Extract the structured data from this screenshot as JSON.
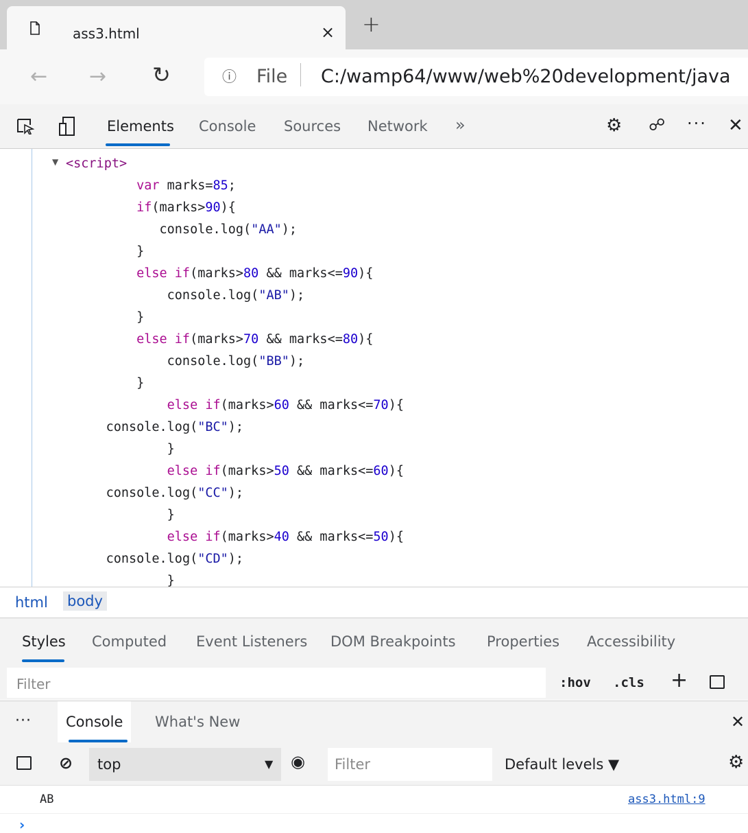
{
  "browser": {
    "tab_title": "ass3.html",
    "tab_close": "×",
    "new_tab": "+",
    "nav_back": "←",
    "nav_forward": "→",
    "nav_reload": "↻",
    "address_info": "ⓘ",
    "address_scheme": "File",
    "address_url": "C:/wamp64/www/web%20development/java"
  },
  "devtools": {
    "tabs": [
      "Elements",
      "Console",
      "Sources",
      "Network"
    ],
    "more_tabs": "»",
    "settings": "⚙",
    "feedback": "☍",
    "more": "···",
    "close": "✕"
  },
  "elements": {
    "lines": [
      {
        "prefix": "",
        "tag": "<script>"
      },
      {
        "indent": "        ",
        "parts": [
          [
            "kw",
            "var"
          ],
          [
            "fn",
            " marks="
          ],
          [
            "num",
            "85"
          ],
          [
            "fn",
            ";"
          ]
        ]
      },
      {
        "indent": "        ",
        "parts": [
          [
            "kw",
            "if"
          ],
          [
            "fn",
            "(marks>"
          ],
          [
            "num",
            "90"
          ],
          [
            "fn",
            "){"
          ]
        ]
      },
      {
        "indent": "           ",
        "parts": [
          [
            "fn",
            "console.log("
          ],
          [
            "str",
            "\"AA\""
          ],
          [
            "fn",
            ");"
          ]
        ]
      },
      {
        "indent": "        ",
        "parts": [
          [
            "fn",
            "}"
          ]
        ]
      },
      {
        "indent": "        ",
        "parts": [
          [
            "kw",
            "else if"
          ],
          [
            "fn",
            "(marks>"
          ],
          [
            "num",
            "80"
          ],
          [
            "fn",
            " && marks<="
          ],
          [
            "num",
            "90"
          ],
          [
            "fn",
            "){"
          ]
        ]
      },
      {
        "indent": "            ",
        "parts": [
          [
            "fn",
            "console.log("
          ],
          [
            "str",
            "\"AB\""
          ],
          [
            "fn",
            ");"
          ]
        ]
      },
      {
        "indent": "        ",
        "parts": [
          [
            "fn",
            "}"
          ]
        ]
      },
      {
        "indent": "        ",
        "parts": [
          [
            "kw",
            "else if"
          ],
          [
            "fn",
            "(marks>"
          ],
          [
            "num",
            "70"
          ],
          [
            "fn",
            " && marks<="
          ],
          [
            "num",
            "80"
          ],
          [
            "fn",
            "){"
          ]
        ]
      },
      {
        "indent": "            ",
        "parts": [
          [
            "fn",
            "console.log("
          ],
          [
            "str",
            "\"BB\""
          ],
          [
            "fn",
            ");"
          ]
        ]
      },
      {
        "indent": "        ",
        "parts": [
          [
            "fn",
            "}"
          ]
        ]
      },
      {
        "indent": "            ",
        "parts": [
          [
            "kw",
            "else if"
          ],
          [
            "fn",
            "(marks>"
          ],
          [
            "num",
            "60"
          ],
          [
            "fn",
            " && marks<="
          ],
          [
            "num",
            "70"
          ],
          [
            "fn",
            "){"
          ]
        ]
      },
      {
        "indent": "    ",
        "parts": [
          [
            "fn",
            "console.log("
          ],
          [
            "str",
            "\"BC\""
          ],
          [
            "fn",
            ");"
          ]
        ]
      },
      {
        "indent": "            ",
        "parts": [
          [
            "fn",
            "}"
          ]
        ]
      },
      {
        "indent": "            ",
        "parts": [
          [
            "kw",
            "else if"
          ],
          [
            "fn",
            "(marks>"
          ],
          [
            "num",
            "50"
          ],
          [
            "fn",
            " && marks<="
          ],
          [
            "num",
            "60"
          ],
          [
            "fn",
            "){"
          ]
        ]
      },
      {
        "indent": "    ",
        "parts": [
          [
            "fn",
            "console.log("
          ],
          [
            "str",
            "\"CC\""
          ],
          [
            "fn",
            ");"
          ]
        ]
      },
      {
        "indent": "            ",
        "parts": [
          [
            "fn",
            "}"
          ]
        ]
      },
      {
        "indent": "            ",
        "parts": [
          [
            "kw",
            "else if"
          ],
          [
            "fn",
            "(marks>"
          ],
          [
            "num",
            "40"
          ],
          [
            "fn",
            " && marks<="
          ],
          [
            "num",
            "50"
          ],
          [
            "fn",
            "){"
          ]
        ]
      },
      {
        "indent": "    ",
        "parts": [
          [
            "fn",
            "console.log("
          ],
          [
            "str",
            "\"CD\""
          ],
          [
            "fn",
            ");"
          ]
        ]
      },
      {
        "indent": "            ",
        "parts": [
          [
            "fn",
            "}"
          ]
        ]
      }
    ]
  },
  "breadcrumb": [
    "html",
    "body"
  ],
  "styles": {
    "tabs": [
      "Styles",
      "Computed",
      "Event Listeners",
      "DOM Breakpoints",
      "Properties",
      "Accessibility"
    ],
    "filter_placeholder": "Filter",
    "hov": ":hov",
    "cls": ".cls",
    "add": "+"
  },
  "drawer": {
    "more": "···",
    "tabs": [
      "Console",
      "What's New"
    ],
    "close": "✕"
  },
  "console": {
    "clear_icon": "⊘",
    "context": "top",
    "context_arrow": "▼",
    "eye_icon": "◉",
    "filter_placeholder": "Filter",
    "levels": "Default levels ▼",
    "settings": "⚙",
    "messages": [
      {
        "text": "AB",
        "source": "ass3.html:9"
      }
    ],
    "prompt": "›"
  },
  "colors": {
    "accent": "#0a6bc8",
    "link": "#1a56b9",
    "keyword": "#aa0d91",
    "number": "#1c00cf",
    "string": "#1a1aa6"
  }
}
